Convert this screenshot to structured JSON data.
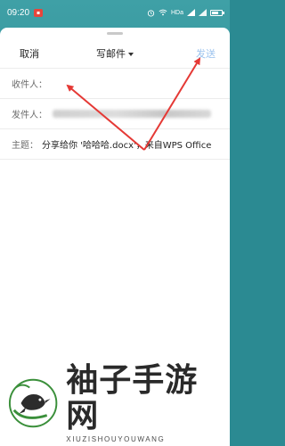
{
  "status_bar": {
    "time": "09:20",
    "app_badge_icon": "red-app-icon",
    "network_label": "HDa",
    "icons": [
      "alarm-icon",
      "wifi-icon",
      "signal-icon",
      "battery-icon"
    ]
  },
  "compose": {
    "cancel_label": "取消",
    "title": "写邮件",
    "title_caret_icon": "caret-down-icon",
    "send_label": "发送",
    "send_color": "#9cc3ee",
    "recipient_label": "收件人：",
    "recipient_value": "",
    "sender_label": "发件人：",
    "subject_label": "主题：",
    "subject_value": "分享给你 '哈哈哈.docx'，来自WPS Office"
  },
  "annotations": {
    "arrow_color": "#e53935",
    "arrows": [
      "arrow-to-recipient",
      "arrow-to-send"
    ]
  },
  "watermark": {
    "title": "袖子手游网",
    "subtitle": "XIUZISHOUYOUWANG"
  }
}
